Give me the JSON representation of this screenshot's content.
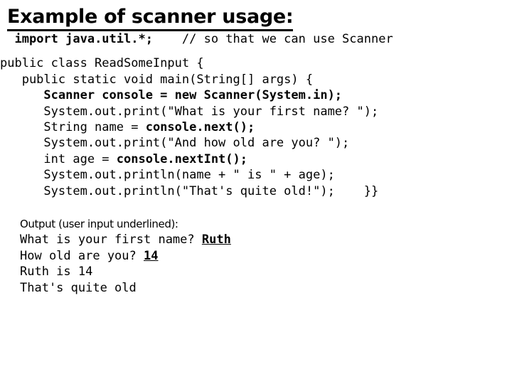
{
  "slide": {
    "title": "Example of scanner usage:",
    "code": {
      "lines": [
        {
          "indent": "  ",
          "segments": [
            {
              "text": "import java.util.*;",
              "bold": true
            },
            {
              "text": "    // so that we can use Scanner",
              "bold": false
            }
          ]
        },
        {
          "indent": "",
          "spacer": true,
          "segments": []
        },
        {
          "indent": "",
          "segments": [
            {
              "text": "public class ReadSomeInput {",
              "bold": false
            }
          ]
        },
        {
          "indent": "",
          "segments": [
            {
              "text": "   public static void main(String[] args) {",
              "bold": false
            }
          ]
        },
        {
          "indent": "",
          "segments": [
            {
              "text": "      Scanner console = new Scanner(System.in);",
              "bold": true
            }
          ]
        },
        {
          "indent": "",
          "segments": [
            {
              "text": "      System.out.print(\"What is your first name? \");",
              "bold": false
            }
          ]
        },
        {
          "indent": "",
          "segments": [
            {
              "text": "      String name = ",
              "bold": false
            },
            {
              "text": "console.next();",
              "bold": true
            }
          ]
        },
        {
          "indent": "",
          "segments": [
            {
              "text": "      System.out.print(\"And how old are you? \");",
              "bold": false
            }
          ]
        },
        {
          "indent": "",
          "segments": [
            {
              "text": "      int age = ",
              "bold": false
            },
            {
              "text": "console.nextInt();",
              "bold": true
            }
          ]
        },
        {
          "indent": "",
          "segments": [
            {
              "text": "      System.out.println(name + \" is \" + age);",
              "bold": false
            }
          ]
        },
        {
          "indent": "",
          "segments": [
            {
              "text": "      System.out.println(\"That's quite old!\");    }}",
              "bold": false
            }
          ]
        }
      ]
    },
    "output": {
      "caption": "Output (user input underlined):",
      "lines": [
        {
          "segments": [
            {
              "text": "What is your first name? ",
              "underlined": false
            },
            {
              "text": "Ruth",
              "underlined": true
            }
          ]
        },
        {
          "segments": [
            {
              "text": "How old are you? ",
              "underlined": false
            },
            {
              "text": "14",
              "underlined": true
            }
          ]
        },
        {
          "segments": [
            {
              "text": "Ruth is 14",
              "underlined": false
            }
          ]
        },
        {
          "segments": [
            {
              "text": "That's quite old",
              "underlined": false
            }
          ]
        }
      ]
    },
    "colors": {
      "background": "#ffffff",
      "text": "#000000"
    }
  }
}
